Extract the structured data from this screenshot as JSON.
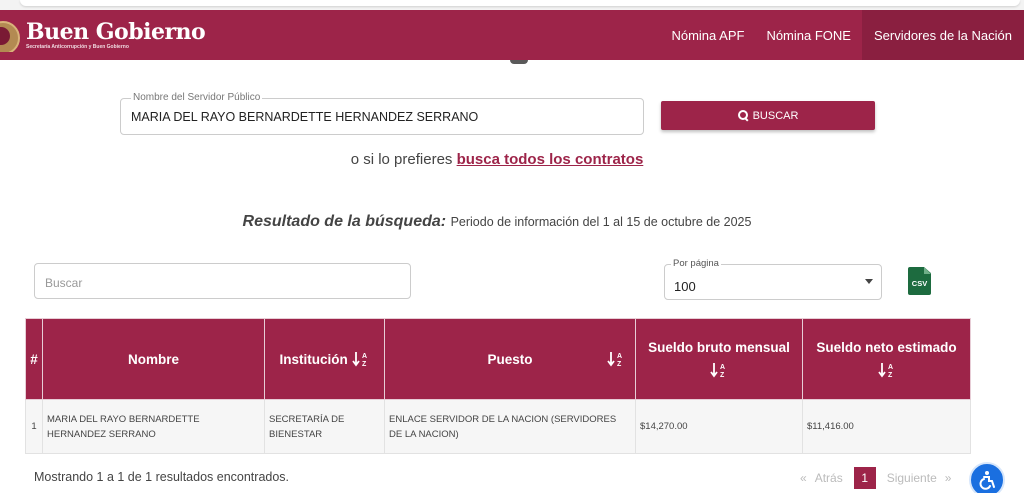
{
  "header": {
    "brand_title": "Buen Gobierno",
    "brand_subtitle": "Secretaría Anticorrupción y Buen Gobierno",
    "nav": [
      {
        "label": "Nómina APF"
      },
      {
        "label": "Nómina FONE"
      },
      {
        "label": "Servidores de la Nación"
      }
    ]
  },
  "search": {
    "field_label": "Nombre del Servidor Público",
    "field_value": "MARIA DEL RAYO BERNARDETTE HERNANDEZ SERRANO",
    "button_label": "BUSCAR",
    "alt_prefix": "o si lo prefieres",
    "alt_link": "busca todos los contratos"
  },
  "results": {
    "heading": "Resultado de la búsqueda:",
    "period": "Periodo de información del 1 al 15 de octubre de 2025",
    "filter_placeholder": "Buscar",
    "per_page_label": "Por página",
    "per_page_value": "100",
    "csv_label": "CSV"
  },
  "table": {
    "headers": [
      "#",
      "Nombre",
      "Institución",
      "Puesto",
      "Sueldo bruto mensual",
      "Sueldo neto estimado"
    ],
    "rows": [
      [
        "1",
        "MARIA DEL RAYO BERNARDETTE HERNANDEZ SERRANO",
        "SECRETARÍA DE BIENESTAR",
        "ENLACE SERVIDOR DE LA NACION (SERVIDORES DE LA NACION)",
        "$14,270.00",
        "$11,416.00"
      ]
    ]
  },
  "footer": {
    "info": "Mostrando 1 a 1 de 1 resultados encontrados.",
    "prev_arrow": "«",
    "prev": "Atrás",
    "current_page": "1",
    "next": "Siguiente",
    "next_arrow": "»"
  },
  "colors": {
    "brand": "#9d2449",
    "brand_active": "#8a1f40",
    "csv_green": "#1d6b3f",
    "accessibility_blue": "#1a6fe0"
  },
  "icons": {
    "search": "search-icon",
    "sort": "sort-alpha-icon",
    "csv": "csv-file-icon",
    "accessibility": "accessibility-icon"
  }
}
